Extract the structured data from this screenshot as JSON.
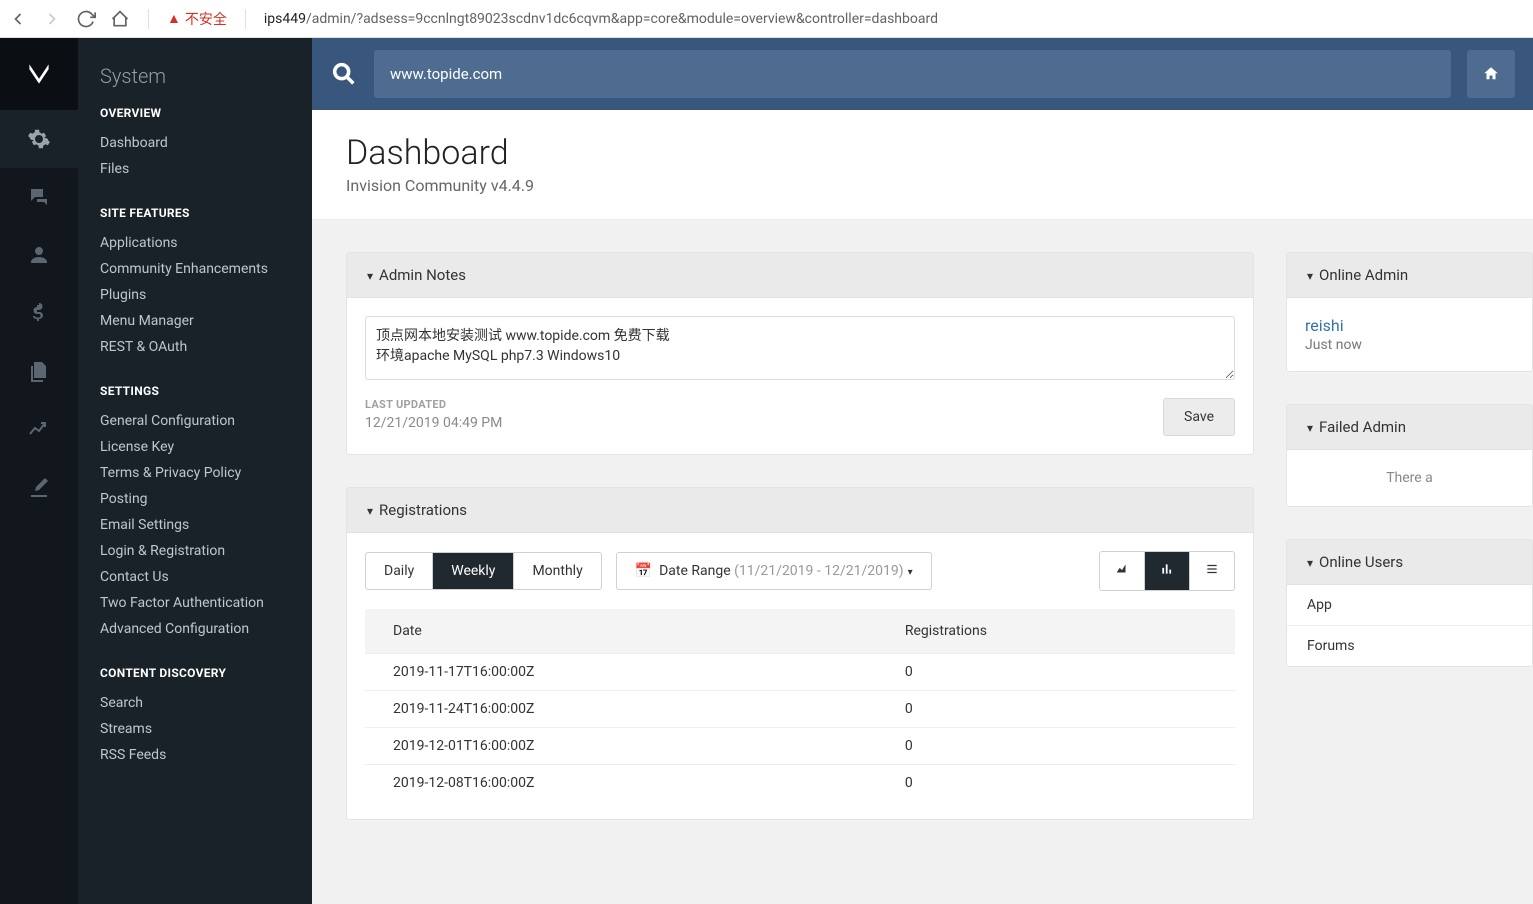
{
  "browser": {
    "warn_text": "不安全",
    "url_host": "ips449",
    "url_path": "/admin/?adsess=9ccnlngt89023scdnv1dc6cqvm&app=core&module=overview&controller=dashboard"
  },
  "sidebar": {
    "title": "System",
    "groups": [
      {
        "label": "OVERVIEW",
        "items": [
          "Dashboard",
          "Files"
        ]
      },
      {
        "label": "SITE FEATURES",
        "items": [
          "Applications",
          "Community Enhancements",
          "Plugins",
          "Menu Manager",
          "REST & OAuth"
        ]
      },
      {
        "label": "SETTINGS",
        "items": [
          "General Configuration",
          "License Key",
          "Terms & Privacy Policy",
          "Posting",
          "Email Settings",
          "Login & Registration",
          "Contact Us",
          "Two Factor Authentication",
          "Advanced Configuration"
        ]
      },
      {
        "label": "CONTENT DISCOVERY",
        "items": [
          "Search",
          "Streams",
          "RSS Feeds"
        ]
      }
    ]
  },
  "search_placeholder": "www.topide.com",
  "header": {
    "title": "Dashboard",
    "subtitle": "Invision Community v4.4.9"
  },
  "admin_notes": {
    "title": "Admin Notes",
    "text": "顶点网本地安装测试 www.topide.com 免费下载\n环境apache MySQL php7.3 Windows10",
    "last_updated_label": "LAST UPDATED",
    "last_updated": "12/21/2019 04:49 PM",
    "save_label": "Save"
  },
  "registrations": {
    "title": "Registrations",
    "tabs": {
      "daily": "Daily",
      "weekly": "Weekly",
      "monthly": "Monthly"
    },
    "date_range_label": "Date Range",
    "date_range_value": "(11/21/2019 - 12/21/2019)",
    "columns": {
      "date": "Date",
      "count": "Registrations"
    },
    "rows": [
      {
        "date": "2019-11-17T16:00:00Z",
        "count": "0"
      },
      {
        "date": "2019-11-24T16:00:00Z",
        "count": "0"
      },
      {
        "date": "2019-12-01T16:00:00Z",
        "count": "0"
      },
      {
        "date": "2019-12-08T16:00:00Z",
        "count": "0"
      }
    ]
  },
  "side": {
    "online_admins": {
      "title": "Online Admin",
      "user": "reishi",
      "time": "Just now"
    },
    "failed_admin": {
      "title": "Failed Admin",
      "empty": "There a"
    },
    "online_users": {
      "title": "Online Users",
      "items": [
        "App",
        "Forums"
      ]
    }
  },
  "chart_data": {
    "type": "table",
    "title": "Registrations",
    "xlabel": "Date",
    "ylabel": "Registrations",
    "categories": [
      "2019-11-17T16:00:00Z",
      "2019-11-24T16:00:00Z",
      "2019-12-01T16:00:00Z",
      "2019-12-08T16:00:00Z"
    ],
    "values": [
      0,
      0,
      0,
      0
    ]
  }
}
